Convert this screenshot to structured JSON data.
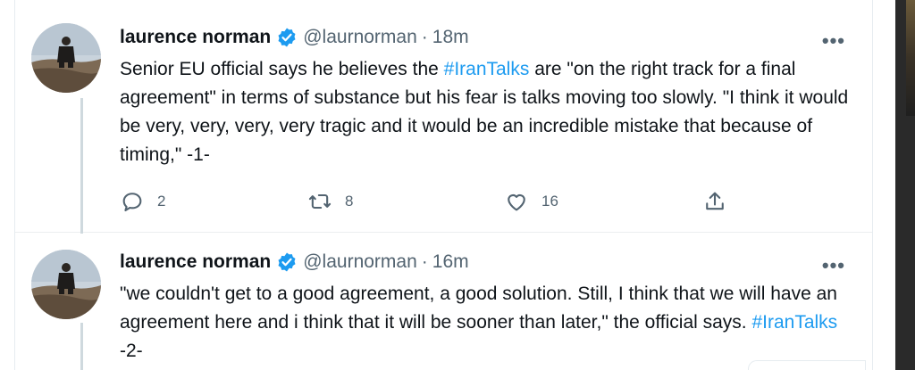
{
  "tweets": [
    {
      "name": "laurence norman",
      "handle": "@laurnorman",
      "separator": "·",
      "time": "18m",
      "text_parts": [
        "Senior EU official says he believes the ",
        "#IranTalks",
        " are \"on the right track for a final agreement\" in terms of substance but his fear is talks moving too slowly. \"I think it would be very, very, very, very tragic and it would be an incredible mistake that because of timing,\" -1-"
      ],
      "replies": "2",
      "retweets": "8",
      "likes": "16"
    },
    {
      "name": "laurence norman",
      "handle": "@laurnorman",
      "separator": "·",
      "time": "16m",
      "text_parts": [
        "\"we couldn't get to a good agreement, a good solution. Still, I think that we will have an agreement here and i think that it will be sooner than later,\" the official says. ",
        "#IranTalks",
        " -2-"
      ]
    }
  ],
  "more_label": "•••",
  "colors": {
    "link": "#1d9bf0",
    "muted": "#536471",
    "text": "#0f1419",
    "verified": "#1d9bf0"
  },
  "icons": [
    "verified-badge-icon",
    "more-icon",
    "reply-icon",
    "retweet-icon",
    "like-icon",
    "share-icon"
  ]
}
